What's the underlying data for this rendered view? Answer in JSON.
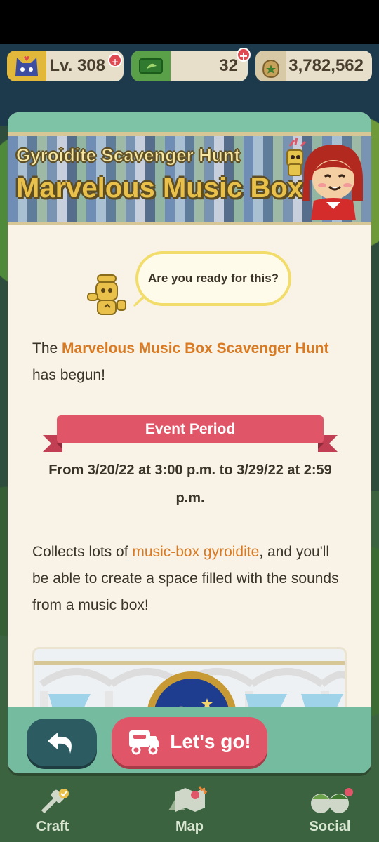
{
  "hud": {
    "level": "Lv. 308",
    "tickets": "32",
    "bells": "3,782,562"
  },
  "banner": {
    "subtitle": "Gyroidite Scavenger Hunt",
    "title": "Marvelous Music Box"
  },
  "speech": "Are you ready for this?",
  "intro": {
    "prefix": "The ",
    "highlight": "Marvelous Music Box Scavenger Hunt",
    "suffix": " has begun!"
  },
  "event": {
    "ribbon": "Event Period",
    "period": "From 3/20/22 at 3:00 p.m. to 3/29/22 at 2:59 p.m."
  },
  "collect": {
    "prefix": "Collects lots of ",
    "highlight": "music-box gyroidite",
    "suffix": ", and you'll be able to create a space filled with the sounds from a music box!"
  },
  "buttons": {
    "go": "Let's go!"
  },
  "nav": {
    "craft": "Craft",
    "map": "Map",
    "social": "Social"
  },
  "colors": {
    "accent_orange": "#d97a22",
    "ribbon_red": "#e05567",
    "dialog_bg": "#f8f3e6",
    "teal": "#75bba0"
  }
}
